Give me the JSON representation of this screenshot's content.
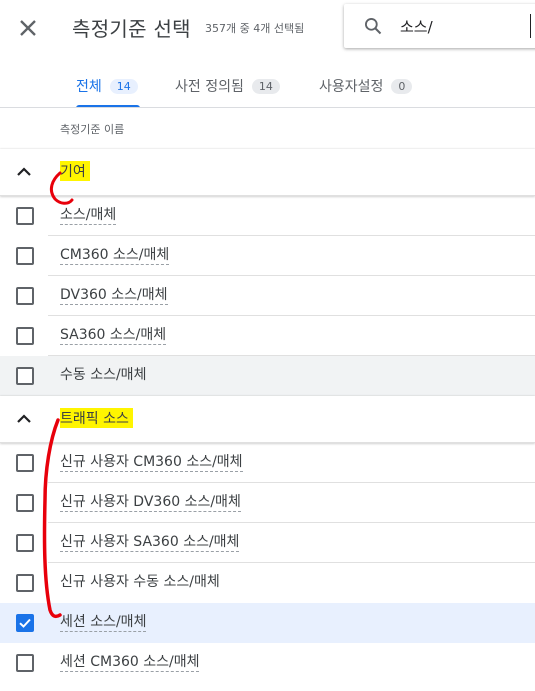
{
  "header": {
    "title": "측정기준 선택",
    "subtitle": "357개 중 4개 선택됨",
    "search_value": "소스/"
  },
  "tabs": [
    {
      "label": "전체",
      "count": "14",
      "active": true
    },
    {
      "label": "사전 정의됨",
      "count": "14",
      "active": false
    },
    {
      "label": "사용자설정",
      "count": "0",
      "active": false
    }
  ],
  "column_header": "측정기준 이름",
  "groups": [
    {
      "label": "기여",
      "items": [
        {
          "label": "소스/매체",
          "checked": false
        },
        {
          "label": "CM360 소스/매체",
          "checked": false
        },
        {
          "label": "DV360 소스/매체",
          "checked": false
        },
        {
          "label": "SA360 소스/매체",
          "checked": false
        },
        {
          "label": "수동 소스/매체",
          "checked": false
        }
      ]
    },
    {
      "label": "트래픽 소스",
      "items": [
        {
          "label": "신규 사용자 CM360 소스/매체",
          "checked": false
        },
        {
          "label": "신규 사용자 DV360 소스/매체",
          "checked": false
        },
        {
          "label": "신규 사용자 SA360 소스/매체",
          "checked": false
        },
        {
          "label": "신규 사용자 수동 소스/매체",
          "checked": false
        },
        {
          "label": "세션 소스/매체",
          "checked": true
        },
        {
          "label": "세션 CM360 소스/매체",
          "checked": false
        }
      ]
    }
  ],
  "colors": {
    "accent": "#1a73e8",
    "highlight": "#fff500",
    "annotation": "#e8000b"
  },
  "icons": [
    "close-icon",
    "search-icon",
    "chevron-up-icon",
    "checkmark-icon"
  ]
}
